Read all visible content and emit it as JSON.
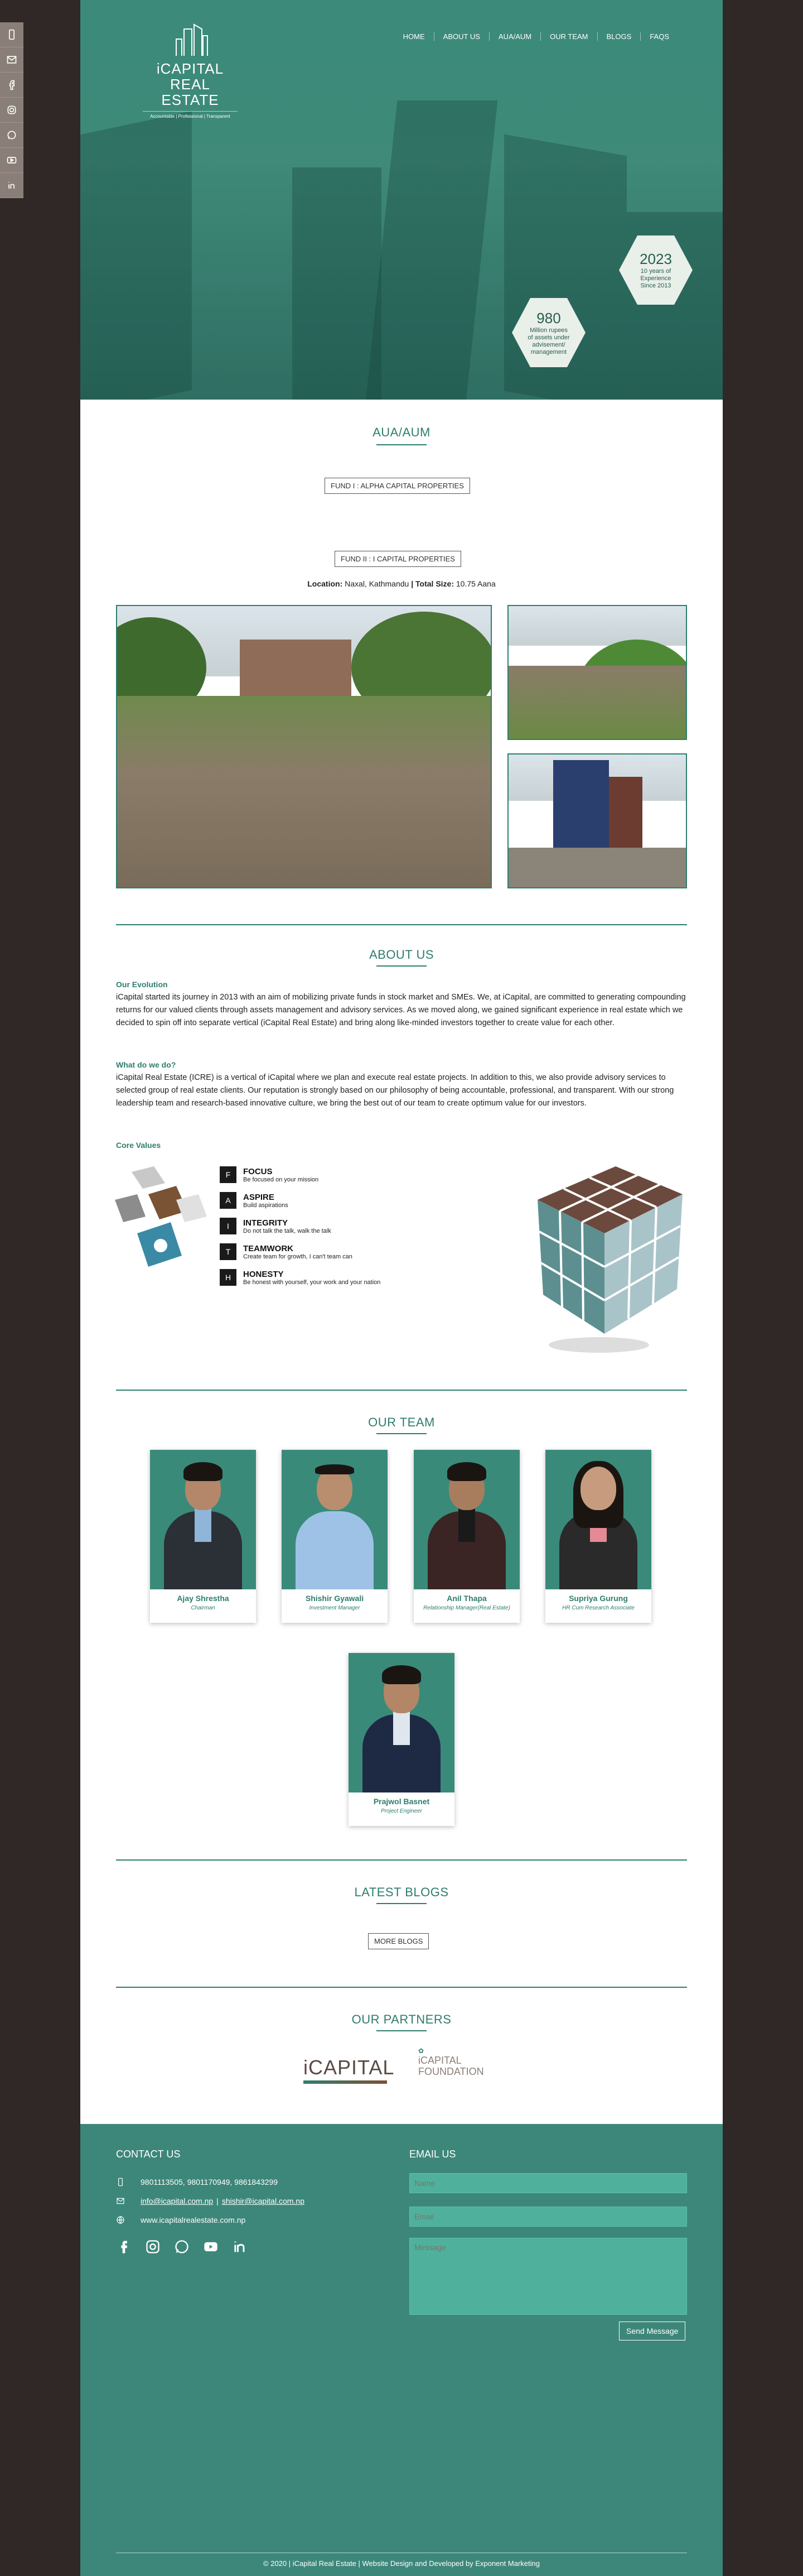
{
  "side_social": [
    "phone-icon",
    "mail-icon",
    "facebook-icon",
    "instagram-icon",
    "whatsapp-icon",
    "youtube-icon",
    "linkedin-icon"
  ],
  "logo": {
    "line1": "iCAPITAL",
    "line2": "REAL ESTATE",
    "tagline": "Accountable | Professional | Transparent"
  },
  "nav": [
    "HOME",
    "ABOUT US",
    "AUA/AUM",
    "OUR TEAM",
    "BLOGS",
    "FAQS"
  ],
  "hero": {
    "badge1": {
      "big": "2023",
      "small": "10 years of Experience Since 2013"
    },
    "badge2": {
      "big": "980",
      "small": "Million rupees of assets under advisement/ management"
    }
  },
  "aua": {
    "title": "AUA/AUM",
    "fund1": "FUND I : ALPHA CAPITAL PROPERTIES",
    "fund2": "FUND II : I CAPITAL PROPERTIES",
    "location_label": "Location:",
    "location_value": "Naxal, Kathmandu",
    "sep": "|",
    "size_label": "Total Size:",
    "size_value": "10.75 Aana"
  },
  "about": {
    "title": "ABOUT US",
    "evolution_h": "Our Evolution",
    "evolution_p": "iCapital started its journey in 2013 with an aim of mobilizing private funds in stock market and SMEs. We, at iCapital, are committed to generating compounding returns for our valued clients through assets management and advisory services. As we moved along, we gained significant experience in real estate which we decided to spin off into separate vertical (iCapital Real Estate) and bring along like-minded investors together to create value for each other.",
    "whatwedo_h": "What do we do?",
    "whatwedo_p": "iCapital Real Estate (ICRE) is a vertical of iCapital where we plan and execute real estate projects. In addition to this, we also provide advisory services to selected group of real estate clients. Our reputation is strongly based on our philosophy of being accountable, professional, and transparent. With our strong leadership team and research-based innovative culture, we bring the best out of our team to create optimum value for our investors.",
    "core_h": "Core Values",
    "values": [
      {
        "letter": "F",
        "name": "FOCUS",
        "desc": "Be focused on your mission"
      },
      {
        "letter": "A",
        "name": "ASPIRE",
        "desc": "Build aspirations"
      },
      {
        "letter": "I",
        "name": "INTEGRITY",
        "desc": "Do not talk the talk, walk the talk"
      },
      {
        "letter": "T",
        "name": "TEAMWORK",
        "desc": "Create team for growth, I can't team can"
      },
      {
        "letter": "H",
        "name": "HONESTY",
        "desc": "Be honest with yourself, your work and your nation"
      }
    ]
  },
  "team": {
    "title": "OUR TEAM",
    "members": [
      {
        "name": "Ajay Shrestha",
        "role": "Chairman"
      },
      {
        "name": "Shishir Gyawali",
        "role": "Investment Manager"
      },
      {
        "name": "Anil Thapa",
        "role": "Relationship Manager(Real Estate)"
      },
      {
        "name": "Supriya Gurung",
        "role": "HR Cum Research Associate"
      },
      {
        "name": "Prajwol Basnet",
        "role": "Project Engineer"
      }
    ]
  },
  "blogs": {
    "title": "LATEST BLOGS",
    "button": "MORE BLOGS"
  },
  "partners": {
    "title": "OUR PARTNERS",
    "p1": "iCAPITAL",
    "p2_line1": "iCAPITAL",
    "p2_line2": "FOUNDATION"
  },
  "footer": {
    "contact_h": "CONTACT US",
    "phones": "9801113505, 9801170949, 9861843299",
    "email1": "info@icapital.com.np",
    "email_sep": "|",
    "email2": "shishir@icapital.com.np",
    "website": "www.icapitalrealestate.com.np",
    "email_h": "EMAIL US",
    "name_ph": "Name",
    "email_ph": "Email",
    "message_ph": "Message",
    "send": "Send Message",
    "copyright": "© 2020 | iCapital Real Estate | Website Design and Developed by Exponent Marketing"
  }
}
